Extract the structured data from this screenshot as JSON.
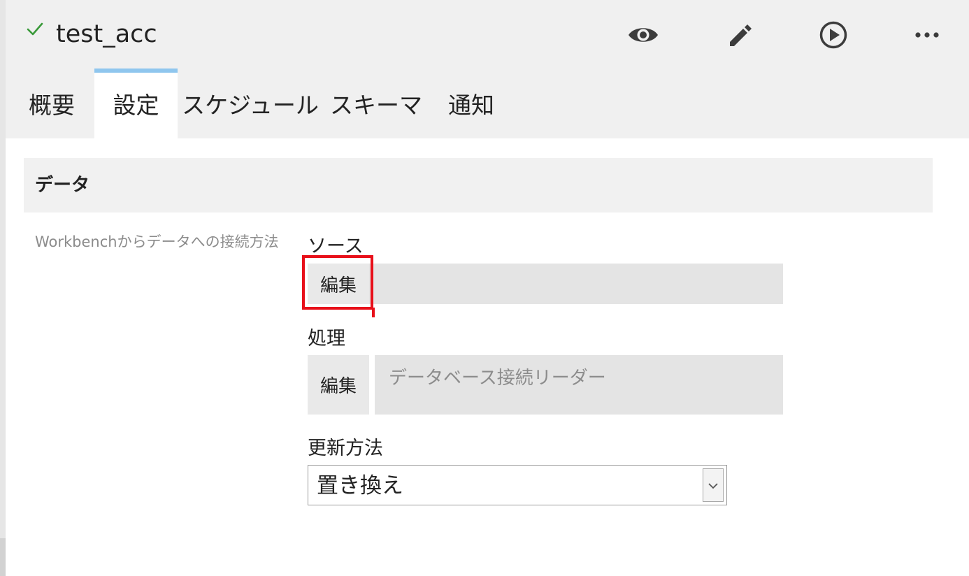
{
  "header": {
    "title": "test_acc",
    "status_icon": "check-icon",
    "status_color": "#3a9a3a",
    "actions": [
      {
        "name": "preview",
        "icon": "eye-icon"
      },
      {
        "name": "edit",
        "icon": "pencil-icon"
      },
      {
        "name": "run",
        "icon": "play-circle-icon"
      },
      {
        "name": "more",
        "icon": "more-horizontal-icon"
      }
    ]
  },
  "tabs": [
    {
      "label": "概要",
      "active": false
    },
    {
      "label": "設定",
      "active": true
    },
    {
      "label": "スケジュール",
      "active": false
    },
    {
      "label": "スキーマ",
      "active": false
    },
    {
      "label": "通知",
      "active": false
    }
  ],
  "section": {
    "title": "データ",
    "description": "Workbenchからデータへの接続方法"
  },
  "source": {
    "label": "ソース",
    "edit_label": "編集",
    "value": ""
  },
  "processing": {
    "label": "処理",
    "edit_label": "編集",
    "value": "データベース接続リーダー"
  },
  "update_method": {
    "label": "更新方法",
    "selected": "置き換え"
  },
  "colors": {
    "accent_tab": "#8fc6ee",
    "highlight": "#e8101a"
  }
}
